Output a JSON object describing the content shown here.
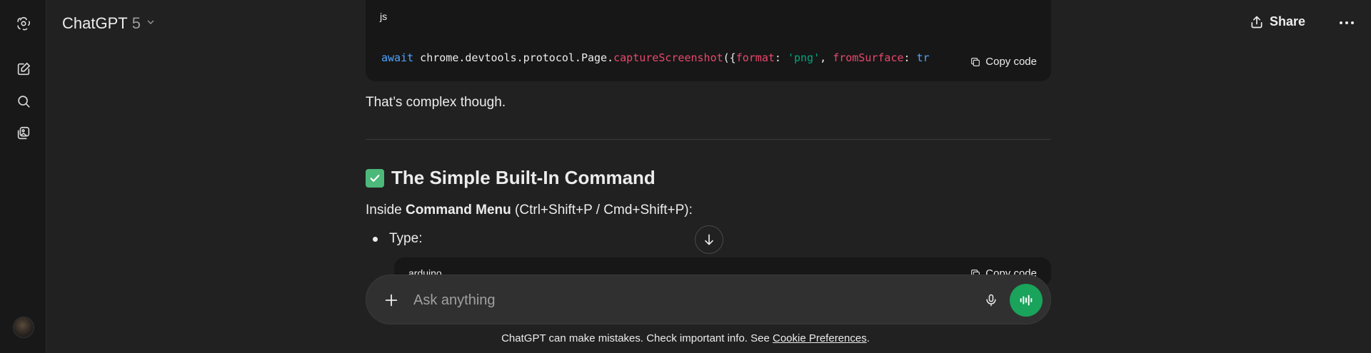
{
  "app": {
    "title": "ChatGPT",
    "model_version": "5"
  },
  "header": {
    "share_label": "Share"
  },
  "sidebar": {
    "icons": [
      "openai-logo-icon",
      "new-chat-icon",
      "search-icon",
      "library-icon"
    ]
  },
  "code_block_1": {
    "language": "js",
    "copy_label": "Copy code",
    "tokens": {
      "await": "await",
      "obj": " chrome.devtools.protocol.Page.",
      "method": "captureScreenshot",
      "open": "({",
      "format_key": "format",
      "colon1": ": ",
      "format_val": "'png'",
      "comma": ", ",
      "surface_key": "fromSurface",
      "colon2": ": ",
      "surface_val": "tr"
    }
  },
  "message": {
    "para1": "That’s complex though.",
    "heading": "The Simple Built-In Command",
    "para2_prefix": "Inside ",
    "para2_bold": "Command Menu",
    "para2_suffix": " (Ctrl+Shift+P / Cmd+Shift+P):",
    "bullet1": "Type:"
  },
  "code_block_2": {
    "language": "arduino",
    "copy_label": "Copy code"
  },
  "composer": {
    "placeholder": "Ask anything"
  },
  "footer": {
    "disclaimer_prefix": "ChatGPT can make mistakes. Check important info. See ",
    "link_label": "Cookie Preferences",
    "disclaimer_suffix": "."
  },
  "colors": {
    "background": "#212121",
    "sidebar": "#181818",
    "voice_button": "#19a35b",
    "check": "#4cb87a"
  }
}
